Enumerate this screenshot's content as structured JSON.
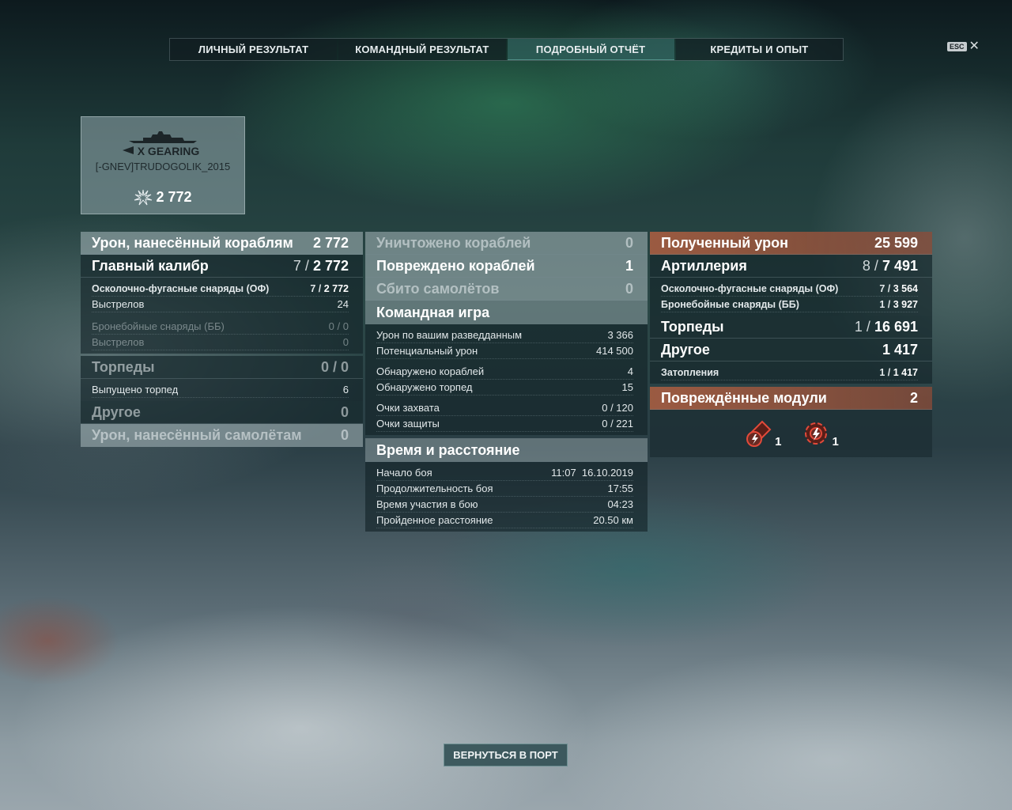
{
  "tabs": [
    {
      "label": "ЛИЧНЫЙ РЕЗУЛЬТАТ"
    },
    {
      "label": "КОМАНДНЫЙ РЕЗУЛЬТАТ"
    },
    {
      "label": "ПОДРОБНЫЙ ОТЧЁТ",
      "active": true
    },
    {
      "label": "КРЕДИТЫ И ОПЫТ"
    }
  ],
  "esc": {
    "key": "ESC",
    "close": "✕"
  },
  "card": {
    "ship": "X GEARING",
    "player": "[-GNEV]TRUDOGOLIK_2015",
    "damage": "2 772"
  },
  "dealt": {
    "title": "Урон, нанесённый кораблям",
    "title_value": "2 772",
    "main": {
      "label": "Главный калибр",
      "a": "7 /",
      "b": "2 772"
    },
    "he": {
      "label": "Осколочно-фугасные снаряды (ОФ)",
      "a": "7 /",
      "b": "2 772"
    },
    "he_shots": {
      "label": "Выстрелов",
      "value": "24"
    },
    "ap": {
      "label": "Бронебойные снаряды (ББ)",
      "a": "0 /",
      "b": "0"
    },
    "ap_shots": {
      "label": "Выстрелов",
      "value": "0"
    },
    "torp": {
      "label": "Торпеды",
      "value": "0 / 0"
    },
    "torp_fired": {
      "label": "Выпущено торпед",
      "value": "6"
    },
    "other": {
      "label": "Другое",
      "value": "0"
    },
    "planes": {
      "label": "Урон, нанесённый самолётам",
      "value": "0"
    }
  },
  "team": {
    "destroyed": {
      "label": "Уничтожено кораблей",
      "value": "0"
    },
    "damaged": {
      "label": "Повреждено кораблей",
      "value": "1"
    },
    "planes": {
      "label": "Сбито самолётов",
      "value": "0"
    },
    "teamplay": "Командная игра",
    "spotdmg": {
      "label": "Урон по вашим разведданным",
      "value": "3 366"
    },
    "potential": {
      "label": "Потенциальный урон",
      "value": "414 500"
    },
    "spotted_ships": {
      "label": "Обнаружено кораблей",
      "value": "4"
    },
    "spotted_torps": {
      "label": "Обнаружено торпед",
      "value": "15"
    },
    "capture": {
      "label": "Очки захвата",
      "value": "0 / 120"
    },
    "defense": {
      "label": "Очки защиты",
      "value": "0 / 221"
    },
    "timedist": "Время и расстояние",
    "start": {
      "label": "Начало боя",
      "value": "11:07  16.10.2019"
    },
    "duration": {
      "label": "Продолжительность боя",
      "value": "17:55"
    },
    "participation": {
      "label": "Время участия в бою",
      "value": "04:23"
    },
    "distance": {
      "label": "Пройденное расстояние",
      "value": "20.50 км"
    }
  },
  "received": {
    "title": "Полученный урон",
    "title_value": "25 599",
    "art": {
      "label": "Артиллерия",
      "a": "8 /",
      "b": "7 491"
    },
    "he": {
      "label": "Осколочно-фугасные снаряды (ОФ)",
      "a": "7 /",
      "b": "3 564"
    },
    "ap": {
      "label": "Бронебойные снаряды (ББ)",
      "a": "1 /",
      "b": "3 927"
    },
    "torp": {
      "label": "Торпеды",
      "a": "1 /",
      "b": "16 691"
    },
    "other": {
      "label": "Другое",
      "value": "1 417"
    },
    "flood": {
      "label": "Затопления",
      "a": "1 /",
      "b": "1 417"
    },
    "modules": {
      "label": "Повреждённые модули",
      "value": "2"
    },
    "mod_items": [
      {
        "icon": "damaged-gun-module-icon",
        "count": "1"
      },
      {
        "icon": "damaged-engine-module-icon",
        "count": "1"
      }
    ]
  },
  "back_button": "ВЕРНУТЬСЯ В ПОРТ",
  "colors": {
    "accent_orange": "#af5f41",
    "tab_active": "#3c7873"
  }
}
